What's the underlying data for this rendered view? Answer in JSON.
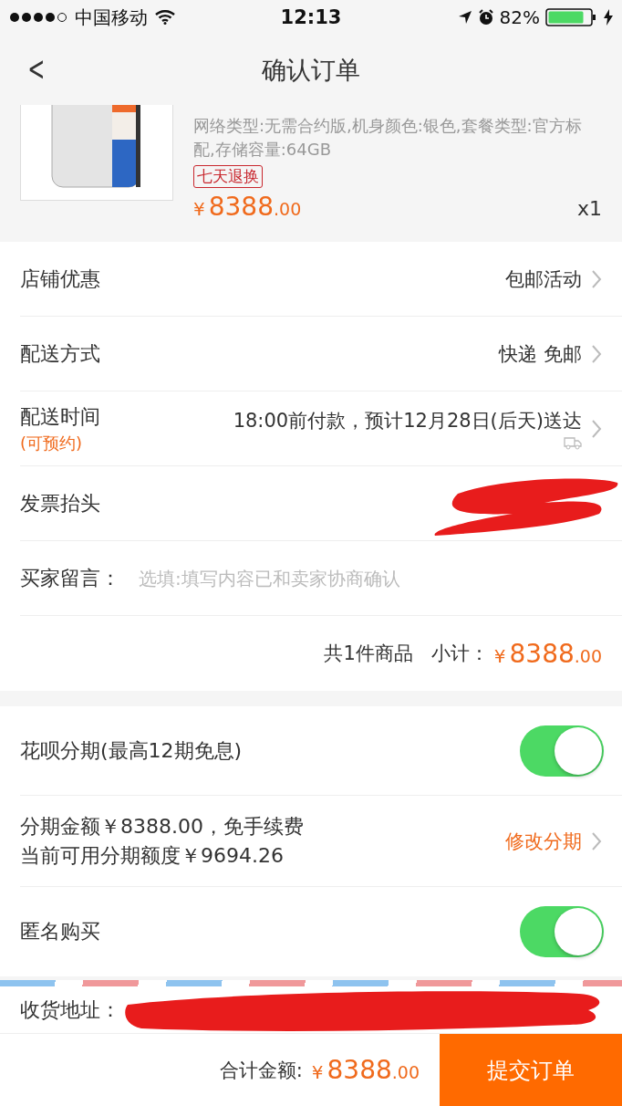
{
  "status_bar": {
    "carrier": "中国移动",
    "time": "12:13",
    "battery": "82%"
  },
  "nav": {
    "back": "<",
    "title": "确认订单"
  },
  "product": {
    "specs": "网络类型:无需合约版,机身颜色:银色,套餐类型:官方标配,存储容量:64GB",
    "tag": "七天退换",
    "currency": "¥",
    "price": "8388",
    "decimal": ".00",
    "quantity": "x1"
  },
  "order_rows": [
    {
      "kind": "link",
      "label": "店铺优惠",
      "value": "包邮活动"
    },
    {
      "kind": "link",
      "label": "配送方式",
      "value": "快递 免邮"
    },
    {
      "kind": "delivery",
      "label": "配送时间",
      "sublabel": "(可预约)",
      "value": "18:00前付款，预计12月28日(后天)送达"
    },
    {
      "kind": "redacted",
      "label": "发票抬头"
    },
    {
      "kind": "input",
      "label": "买家留言：",
      "placeholder": "选填:填写内容已和卖家协商确认"
    },
    {
      "kind": "subtotal",
      "count": "共1件商品",
      "label": "小计：",
      "currency": "¥",
      "price": "8388",
      "decimal": ".00"
    }
  ],
  "payment_rows": [
    {
      "kind": "toggle",
      "label": "花呗分期(最高12期免息)",
      "on": true
    },
    {
      "kind": "installment",
      "line1": "分期金额￥8388.00，免手续费",
      "line2": "当前可用分期额度￥9694.26",
      "action": "修改分期"
    },
    {
      "kind": "toggle",
      "label": "匿名购买",
      "on": true
    }
  ],
  "address": {
    "label": "收货地址："
  },
  "footer": {
    "label": "合计金额:",
    "currency": "¥",
    "price": "8388",
    "decimal": ".00",
    "submit": "提交订单"
  }
}
